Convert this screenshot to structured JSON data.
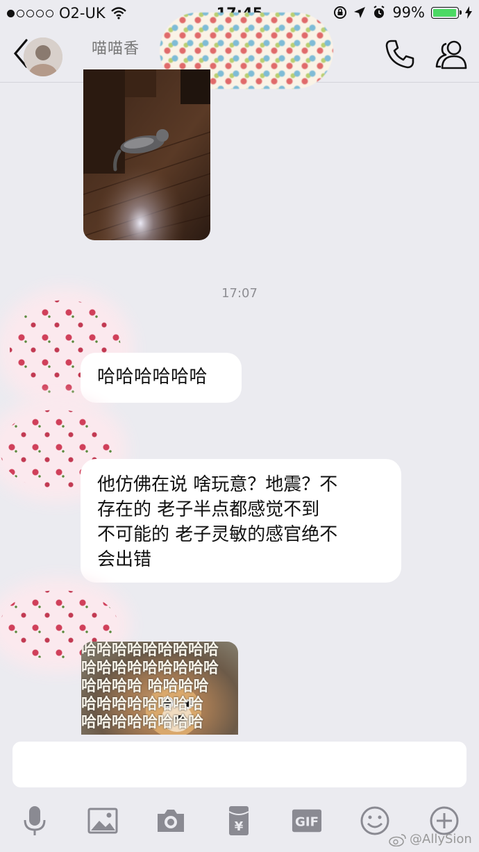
{
  "status_bar": {
    "carrier": "O2-UK",
    "time": "17:45",
    "battery": "99%",
    "signal_dots_filled": 1,
    "signal_dots_total": 5
  },
  "header": {
    "contact_name": "喵喵香"
  },
  "chat": {
    "timestamp": "17:07",
    "messages": [
      {
        "type": "image",
        "icon": "cat-photo"
      },
      {
        "type": "text",
        "text": "哈哈哈哈哈哈"
      },
      {
        "type": "text",
        "lines": [
          "他仿佛在说 啥玩意？地震？不",
          "存在的 老子半点都感觉不到",
          "不可能的 老子灵敏的感官绝不",
          "会出错"
        ]
      },
      {
        "type": "image",
        "icon": "dog-meme",
        "meme_lines": [
          "哈哈哈哈哈哈哈哈哈",
          "哈哈哈哈哈哈哈哈哈",
          "哈哈哈哈  哈哈哈哈",
          "哈哈哈哈哈哈哈哈",
          "哈哈哈哈哈哈哈哈"
        ]
      }
    ]
  },
  "input": {
    "placeholder": ""
  },
  "toolbar": [
    {
      "icon": "microphone-icon"
    },
    {
      "icon": "image-icon"
    },
    {
      "icon": "camera-icon"
    },
    {
      "icon": "red-packet-icon",
      "label": "¥"
    },
    {
      "icon": "gif-icon",
      "label": "GIF"
    },
    {
      "icon": "emoji-icon"
    },
    {
      "icon": "plus-icon"
    }
  ],
  "watermark": "@AllySion",
  "colors": {
    "background": "#ebebf0",
    "bubble": "#ffffff",
    "battery": "#4cd964"
  }
}
